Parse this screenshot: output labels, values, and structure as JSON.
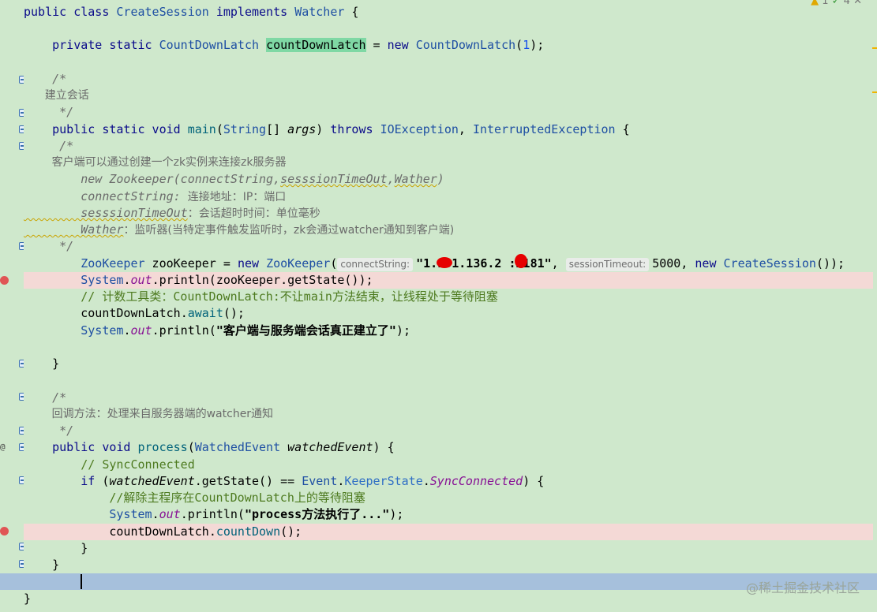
{
  "editor": {
    "inspections": {
      "warnings": "1",
      "checks": "4",
      "close": "✕"
    },
    "watermark": "@稀土掘金技术社区",
    "lines": {
      "l1": {
        "kw1": "public class ",
        "cls": "CreateSession",
        "kw2": " implements ",
        "iface": "Watcher",
        "rest": " {"
      },
      "l2": {
        "kw": "    private static ",
        "cls": "CountDownLatch",
        "sp": " ",
        "field": "countDownLatch",
        "eq": " = ",
        "new": "new ",
        "cls2": "CountDownLatch",
        "open": "(",
        "num": "1",
        "close": ");"
      },
      "l3": "    /*",
      "l4": "      建立会话",
      "l5": "     */",
      "l6": {
        "kw": "    public static void ",
        "fn": "main",
        "p1": "(",
        "cls": "String",
        "p2": "[] ",
        "arg": "args",
        "p3": ") ",
        "throws": "throws ",
        "ex1": "IOException",
        "comma": ", ",
        "ex2": "InterruptedException",
        "p4": " {"
      },
      "l7": "     /*",
      "l8": "        客户端可以通过创建一个zk实例来连接zk服务器",
      "l9": {
        "a": "        new Zookeeper(connectString,",
        "b": "sesssionTimeOut",
        "c": ",",
        "d": "Wather",
        "e": ")"
      },
      "l10": {
        "a": "        connectString: ",
        "b": "连接地址：IP：端口"
      },
      "l11": {
        "a": "        sesssionTimeOut",
        "b": "：会话超时时间：单位毫秒"
      },
      "l12": {
        "a": "        Wather",
        "b": "：监听器(当特定事件触发监听时，zk会通过watcher通知到客户端)"
      },
      "l13": "     */",
      "l14": {
        "cls": "        ZooKeeper",
        "var": " zooKeeper = ",
        "new": "new ",
        "cls2": "ZooKeeper",
        "open": "(",
        "hint1": "connectString:",
        "str": "\"1.101.136.2 :2181\"",
        "comma": ",",
        "hint2": "sessionTimeout:",
        "num": "5000",
        "comma2": ", ",
        "new2": "new ",
        "cls3": "CreateSession",
        "close": "());"
      },
      "l15": {
        "cls": "        System",
        "dot": ".",
        "fld": "out",
        "rest": ".println(zooKeeper.getState());"
      },
      "l16": "        // 计数工具类：CountDownLatch:不让main方法结束，让线程处于等待阻塞",
      "l17": {
        "a": "        countDownLatch",
        "b": ".",
        "c": "await",
        "d": "();"
      },
      "l18": {
        "cls": "        System",
        "dot": ".",
        "fld": "out",
        "a": ".println(",
        "str": "\"客户端与服务端会话真正建立了\"",
        "b": ");"
      },
      "l19": "    }",
      "l20": "    /*",
      "l21": "        回调方法：处理来自服务器端的watcher通知",
      "l22": "     */",
      "l23": {
        "kw": "    public void ",
        "fn": "process",
        "p1": "(",
        "cls": "WatchedEvent",
        "sp": " ",
        "arg": "watchedEvent",
        "p2": ") {"
      },
      "l24": "        // SyncConnected",
      "l25": {
        "kw": "        if ",
        "a": "(",
        "arg": "watchedEvent",
        "b": ".getState() == ",
        "cls": "Event",
        "c": ".",
        "st": "KeeperState",
        "d": ".",
        "fld": "SyncConnected",
        "e": ") {"
      },
      "l26": "            //解除主程序在CountDownLatch上的等待阻塞",
      "l27": {
        "cls": "            System",
        "dot": ".",
        "fld": "out",
        "a": ".println(",
        "str": "\"process方法执行了...\"",
        "b": ");"
      },
      "l28": {
        "a": "            countDownLatch",
        "b": ".",
        "c": "countDown",
        "d": "();"
      },
      "l29": "        }",
      "l30": "    }",
      "l31": "}"
    }
  }
}
